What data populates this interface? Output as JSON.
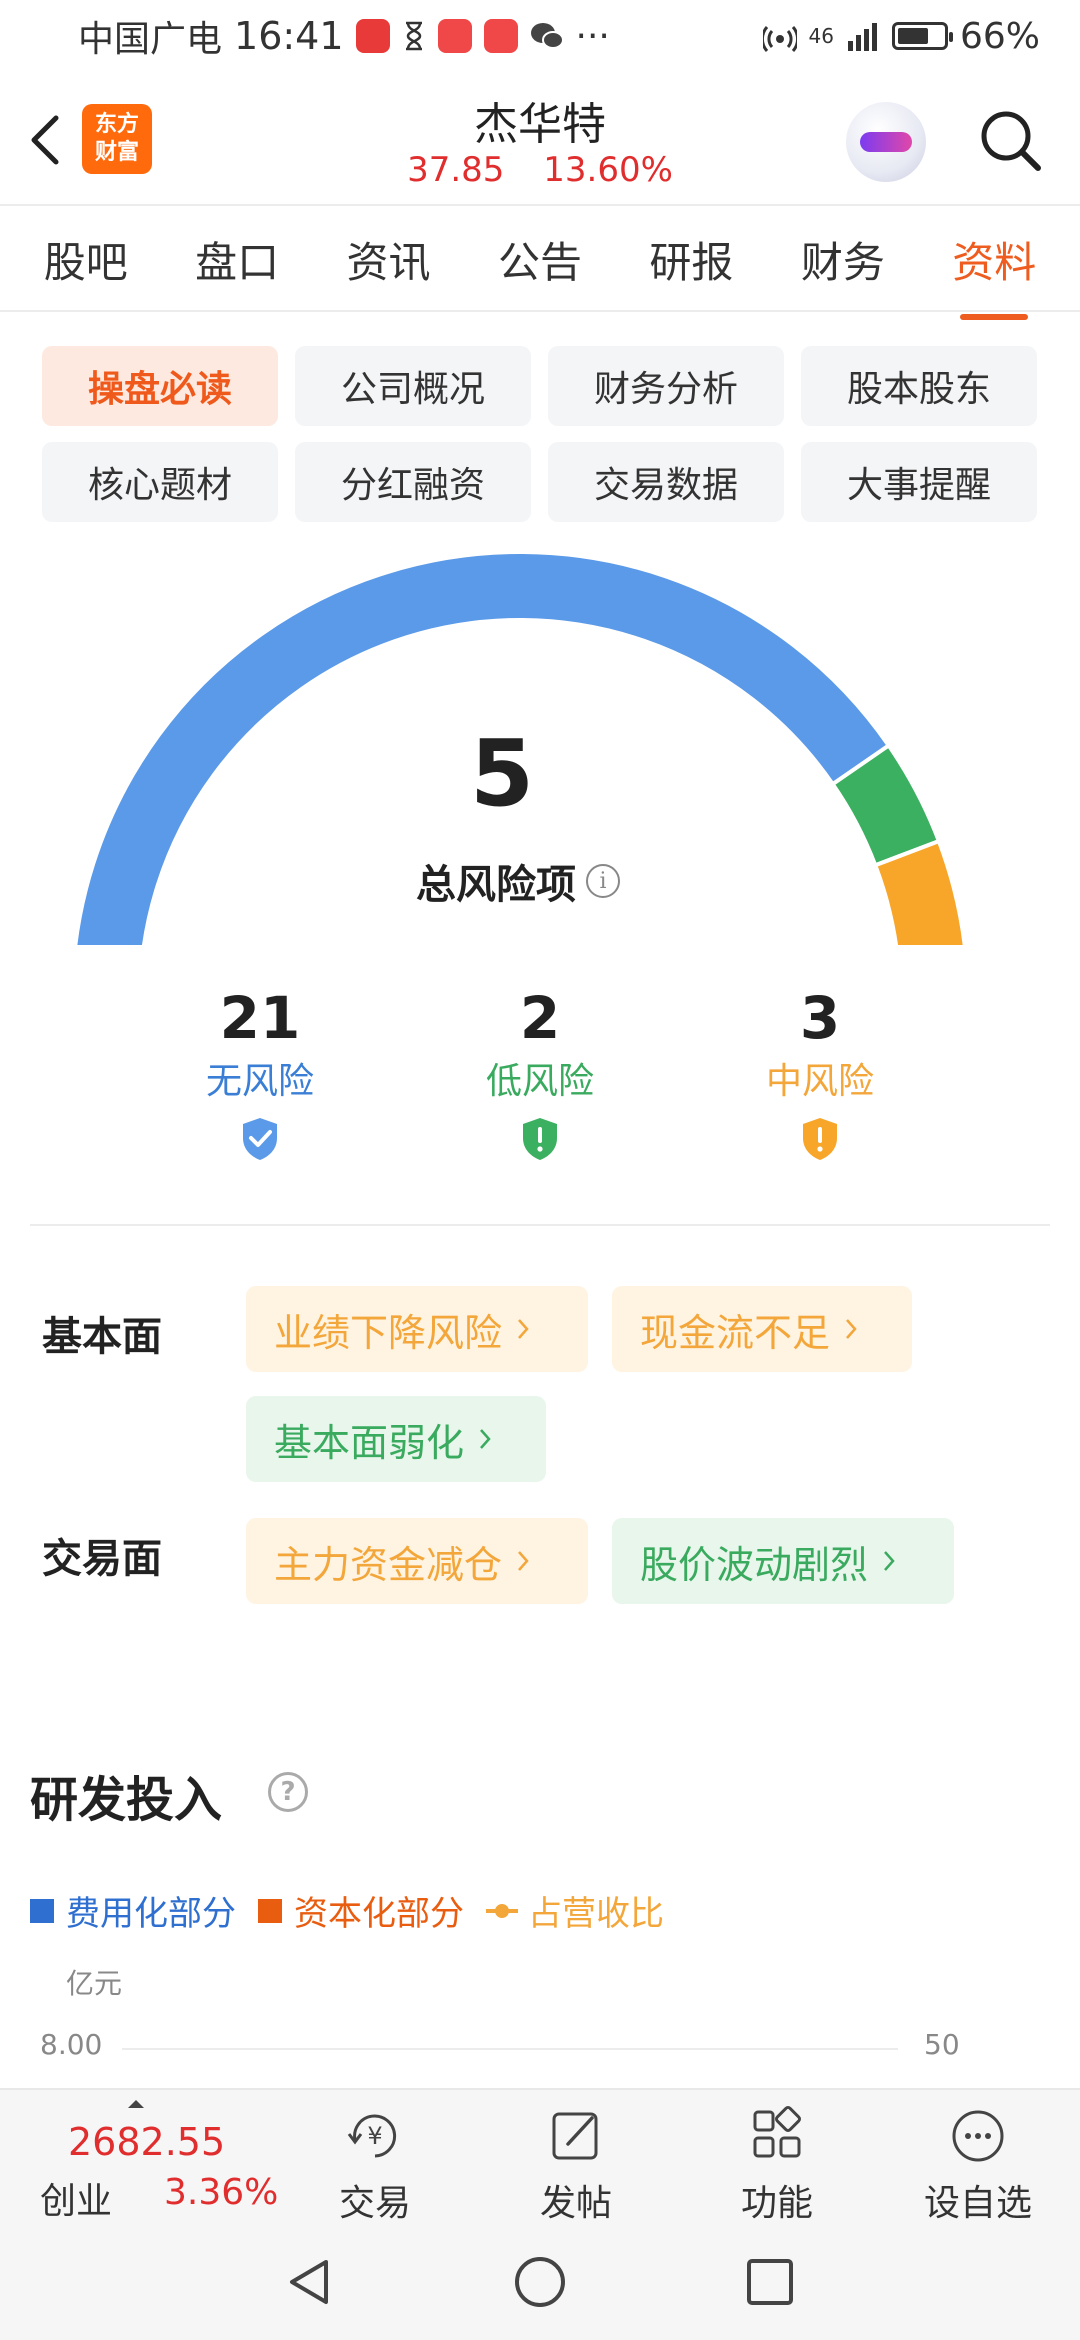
{
  "status_bar": {
    "carrier": "中国广电",
    "time": "16:41",
    "more": "···",
    "network": "46",
    "battery": "66%"
  },
  "header": {
    "logo_text_1": "东方",
    "logo_text_2": "财富",
    "stock_name": "杰华特",
    "price": "37.85",
    "change_pct": "13.60%"
  },
  "tabs": [
    "股吧",
    "盘口",
    "资讯",
    "公告",
    "研报",
    "财务",
    "资料"
  ],
  "active_tab": "资料",
  "submenu": [
    "操盘必读",
    "公司概况",
    "财务分析",
    "股本股东",
    "核心题材",
    "分红融资",
    "交易数据",
    "大事提醒"
  ],
  "risk": {
    "total": "5",
    "total_label": "总风险项",
    "info_glyph": "i",
    "gauge_segments": [
      {
        "name": "无风险",
        "value": 21,
        "color": "#5b9ae8"
      },
      {
        "name": "低风险",
        "value": 2,
        "color": "#3cb061"
      },
      {
        "name": "中风险",
        "value": 3,
        "color": "#f8a62a"
      }
    ],
    "stats": [
      {
        "value": "21",
        "label": "无风险",
        "color": "#3a7fd5",
        "icon": "check-shield-icon"
      },
      {
        "value": "2",
        "label": "低风险",
        "color": "#3aaa5f",
        "icon": "alert-shield-icon"
      },
      {
        "value": "3",
        "label": "中风险",
        "color": "#f3a63a",
        "icon": "alert-shield-icon"
      }
    ],
    "fundamental_label": "基本面",
    "fundamental_tags": [
      {
        "text": "业绩下降风险",
        "level": "orange"
      },
      {
        "text": "现金流不足",
        "level": "orange"
      },
      {
        "text": "基本面弱化",
        "level": "green"
      }
    ],
    "trading_label": "交易面",
    "trading_tags": [
      {
        "text": "主力资金减仓",
        "level": "orange"
      },
      {
        "text": "股价波动剧烈",
        "level": "green"
      }
    ]
  },
  "rd": {
    "title": "研发投入",
    "help_glyph": "?",
    "legend": [
      {
        "text": "费用化部分",
        "color": "#2f6fd0"
      },
      {
        "text": "资本化部分",
        "color": "#e85d10"
      },
      {
        "text": "占营收比",
        "color": "#f3a63a"
      }
    ],
    "unit": "亿元",
    "y_left_top": "8.00",
    "y_right_top": "50"
  },
  "bottom_nav": {
    "index_value": "2682.55",
    "index_name": "创业",
    "index_change": "3.36%",
    "items": [
      "交易",
      "发帖",
      "功能",
      "设自选"
    ]
  }
}
